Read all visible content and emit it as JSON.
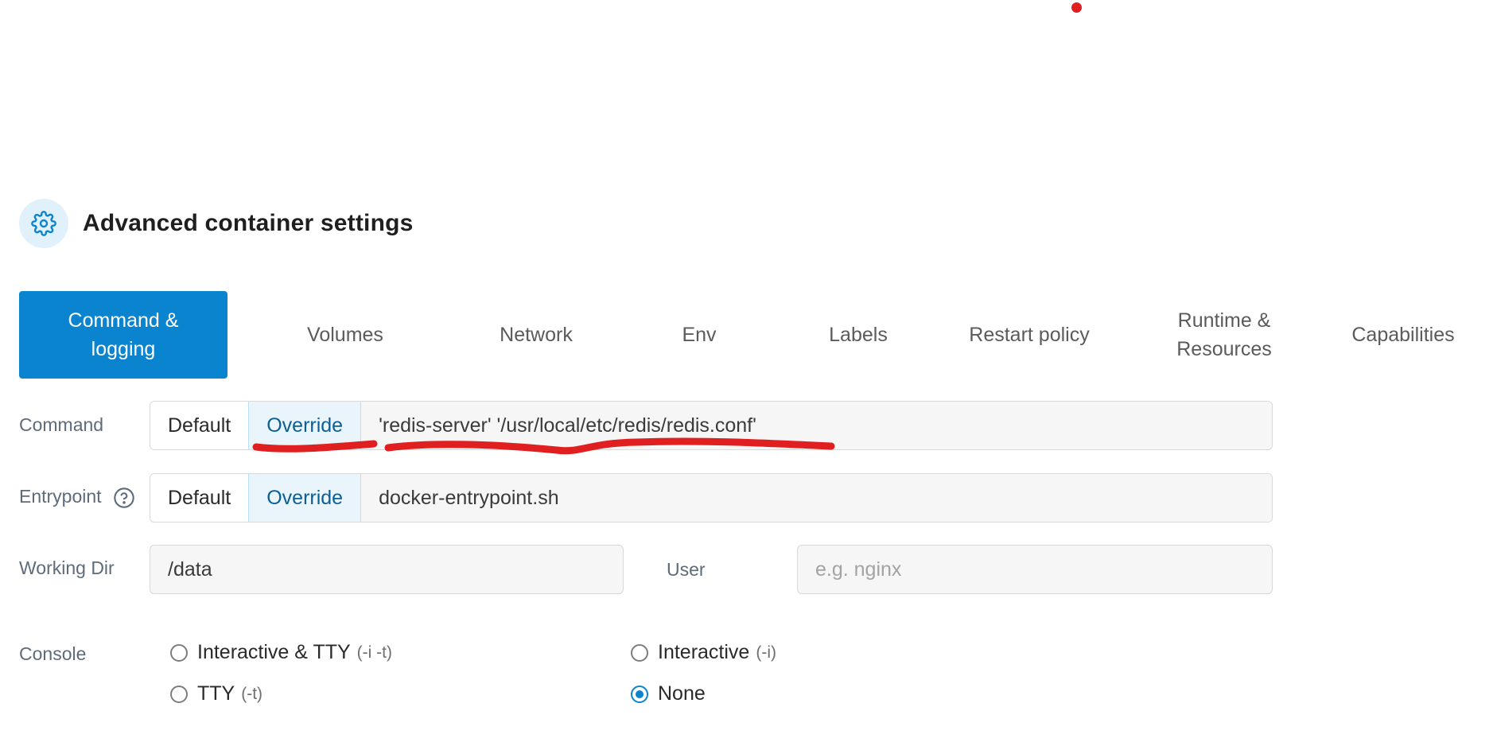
{
  "section": {
    "title": "Advanced container settings",
    "icon": "gear-icon"
  },
  "tabs": [
    {
      "label": "Command & logging",
      "active": true
    },
    {
      "label": "Volumes",
      "active": false
    },
    {
      "label": "Network",
      "active": false
    },
    {
      "label": "Env",
      "active": false
    },
    {
      "label": "Labels",
      "active": false
    },
    {
      "label": "Restart policy",
      "active": false
    },
    {
      "label": "Runtime & Resources",
      "active": false
    },
    {
      "label": "Capabilities",
      "active": false
    }
  ],
  "command": {
    "label": "Command",
    "default_label": "Default",
    "override_label": "Override",
    "value": "'redis-server' '/usr/local/etc/redis/redis.conf'"
  },
  "entrypoint": {
    "label": "Entrypoint",
    "help_icon": "question-circle-icon",
    "default_label": "Default",
    "override_label": "Override",
    "value": "docker-entrypoint.sh"
  },
  "working_dir": {
    "label": "Working Dir",
    "value": "/data"
  },
  "user": {
    "label": "User",
    "value": "",
    "placeholder": "e.g. nginx"
  },
  "console": {
    "label": "Console",
    "options": [
      {
        "label": "Interactive & TTY",
        "hint": "(-i -t)",
        "checked": false
      },
      {
        "label": "Interactive",
        "hint": "(-i)",
        "checked": false
      },
      {
        "label": "TTY",
        "hint": "(-t)",
        "checked": false
      },
      {
        "label": "None",
        "hint": "",
        "checked": true
      }
    ]
  },
  "colors": {
    "accent": "#0b84cf",
    "annotation": "#e02020"
  }
}
